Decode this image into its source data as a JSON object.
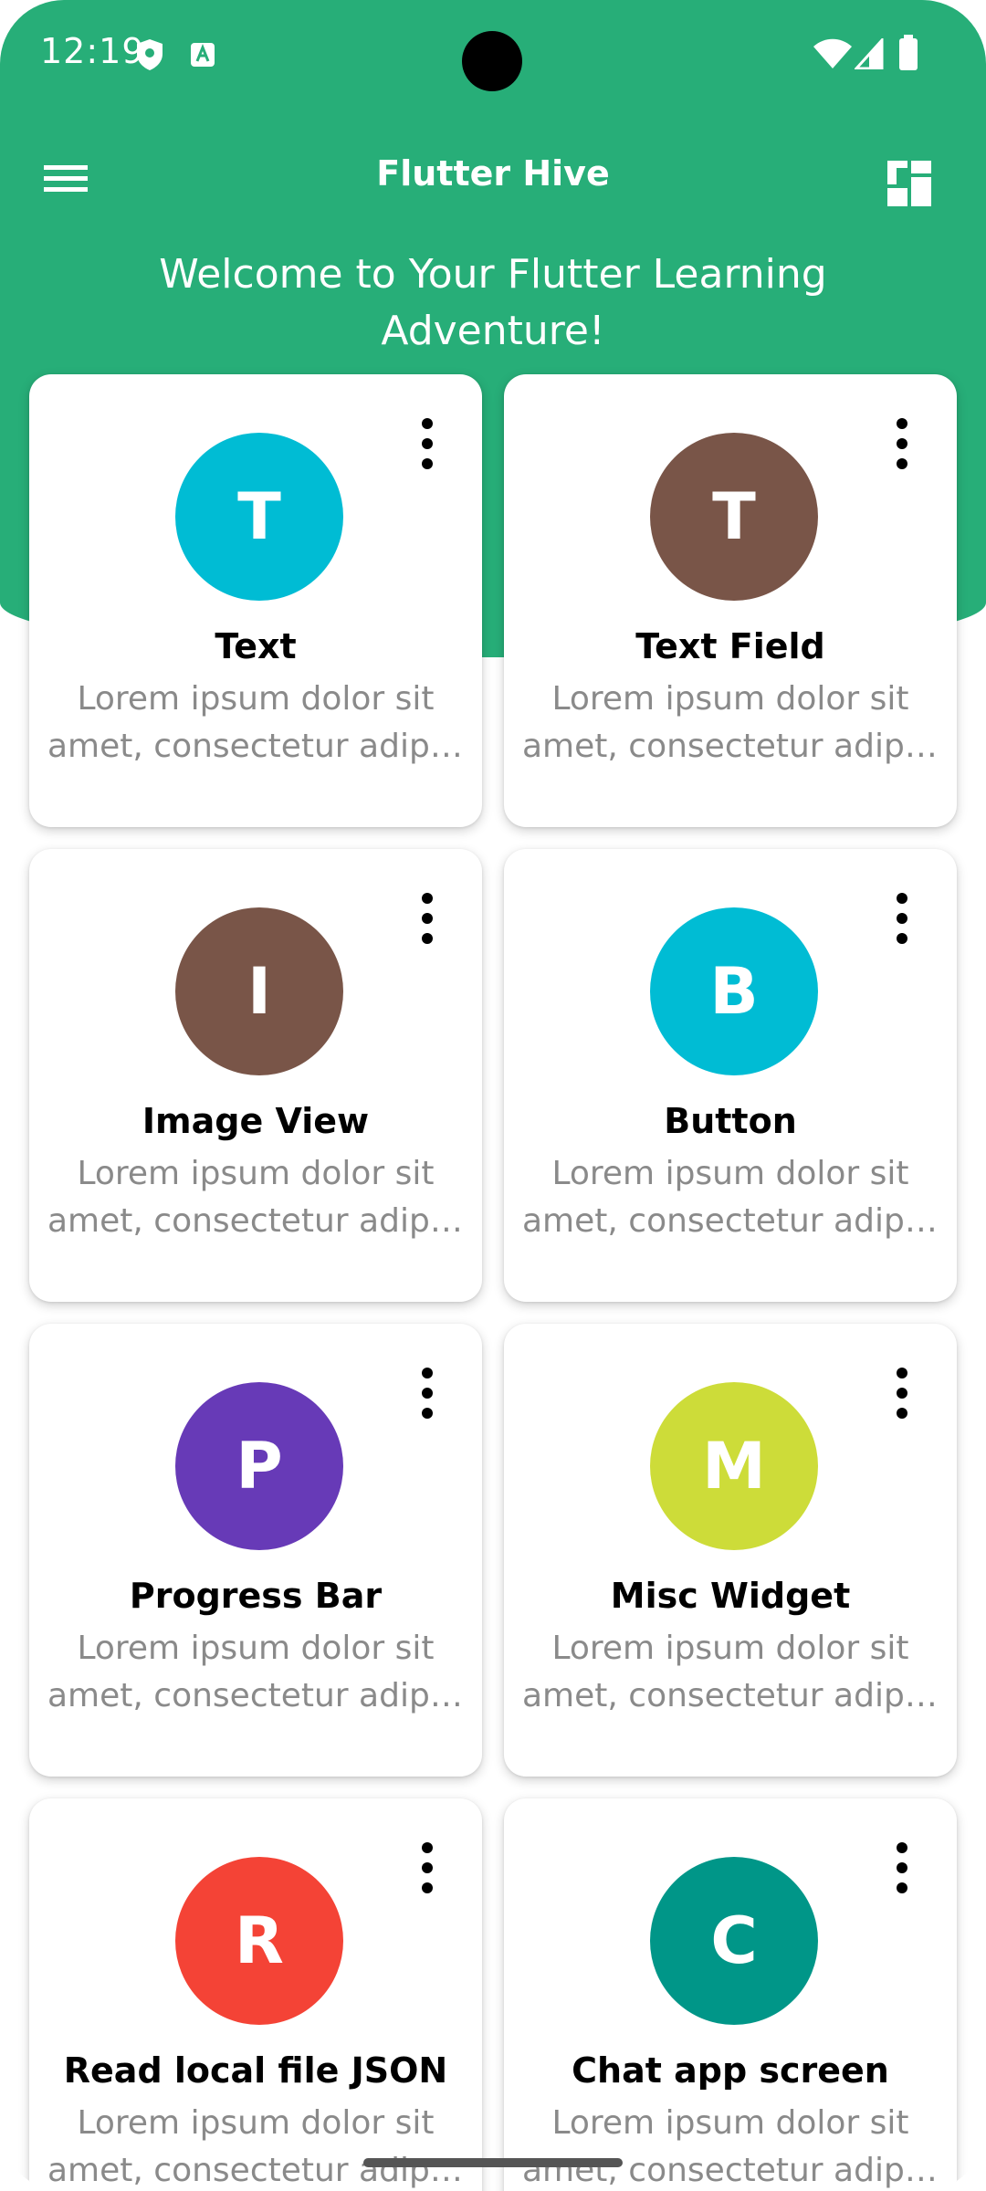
{
  "status_bar": {
    "time": "12:19",
    "icons": [
      "shield-icon",
      "a-notification-icon",
      "wifi-icon",
      "signal-icon",
      "battery-icon"
    ]
  },
  "app_bar": {
    "title": "Flutter Hive",
    "menu_icon": "menu-icon",
    "layout_icon": "dashboard-layout-icon"
  },
  "welcome": {
    "line1": "Welcome to Your Flutter Learning",
    "line2": "Adventure!"
  },
  "colors": {
    "primary": "#27ae78",
    "cyan": "#00bcd4",
    "brown": "#795548",
    "purple": "#673ab7",
    "lime": "#cddc39",
    "red": "#f44336",
    "teal": "#009688"
  },
  "cards": [
    {
      "letter": "T",
      "title": "Text",
      "desc1": "Lorem ipsum dolor sit",
      "desc2": "amet, consectetur adipi…",
      "color": "#00bcd4"
    },
    {
      "letter": "T",
      "title": "Text Field",
      "desc1": "Lorem ipsum dolor sit",
      "desc2": "amet, consectetur adipi…",
      "color": "#795548"
    },
    {
      "letter": "I",
      "title": "Image View",
      "desc1": "Lorem ipsum dolor sit",
      "desc2": "amet, consectetur adipi…",
      "color": "#795548"
    },
    {
      "letter": "B",
      "title": "Button",
      "desc1": "Lorem ipsum dolor sit",
      "desc2": "amet, consectetur adipi…",
      "color": "#00bcd4"
    },
    {
      "letter": "P",
      "title": "Progress Bar",
      "desc1": "Lorem ipsum dolor sit",
      "desc2": "amet, consectetur adipi…",
      "color": "#673ab7"
    },
    {
      "letter": "M",
      "title": "Misc Widget",
      "desc1": "Lorem ipsum dolor sit",
      "desc2": "amet, consectetur adipi…",
      "color": "#cddc39"
    },
    {
      "letter": "R",
      "title": "Read local file JSON",
      "desc1": "Lorem ipsum dolor sit",
      "desc2": "amet, consectetur adipi…",
      "color": "#f44336"
    },
    {
      "letter": "C",
      "title": "Chat app screen",
      "desc1": "Lorem ipsum dolor sit",
      "desc2": "amet, consectetur adipi…",
      "color": "#009688"
    }
  ]
}
